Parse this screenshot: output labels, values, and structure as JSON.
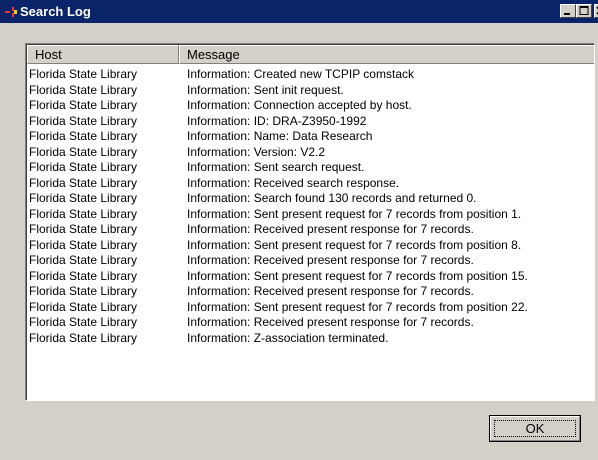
{
  "window": {
    "title": "Search Log",
    "icon": "app-icon"
  },
  "caption_buttons": {
    "minimize_icon": "minimize-icon",
    "maximize_icon": "maximize-icon",
    "close_icon": "close-icon"
  },
  "log": {
    "columns": {
      "host": "Host",
      "message": "Message"
    },
    "rows": [
      {
        "host": "Florida State Library",
        "message": "Information: Created new TCPIP comstack"
      },
      {
        "host": "Florida State Library",
        "message": "Information: Sent init request."
      },
      {
        "host": "Florida State Library",
        "message": "Information: Connection accepted by host."
      },
      {
        "host": "Florida State Library",
        "message": "Information: ID: DRA-Z3950-1992"
      },
      {
        "host": "Florida State Library",
        "message": "Information: Name: Data Research"
      },
      {
        "host": "Florida State Library",
        "message": "Information: Version: V2.2"
      },
      {
        "host": "Florida State Library",
        "message": "Information: Sent search request."
      },
      {
        "host": "Florida State Library",
        "message": "Information: Received search response."
      },
      {
        "host": "Florida State Library",
        "message": "Information: Search found 130 records and returned 0."
      },
      {
        "host": "Florida State Library",
        "message": "Information: Sent present request for 7 records from position 1."
      },
      {
        "host": "Florida State Library",
        "message": "Information: Received present response for 7 records."
      },
      {
        "host": "Florida State Library",
        "message": "Information: Sent present request for 7 records from position 8."
      },
      {
        "host": "Florida State Library",
        "message": "Information: Received present response for 7 records."
      },
      {
        "host": "Florida State Library",
        "message": "Information: Sent present request for 7 records from position 15."
      },
      {
        "host": "Florida State Library",
        "message": "Information: Received present response for 7 records."
      },
      {
        "host": "Florida State Library",
        "message": "Information: Sent present request for 7 records from position 22."
      },
      {
        "host": "Florida State Library",
        "message": "Information: Received present response for 7 records."
      },
      {
        "host": "Florida State Library",
        "message": "Information: Z-association terminated."
      }
    ]
  },
  "buttons": {
    "ok_label": "OK"
  }
}
